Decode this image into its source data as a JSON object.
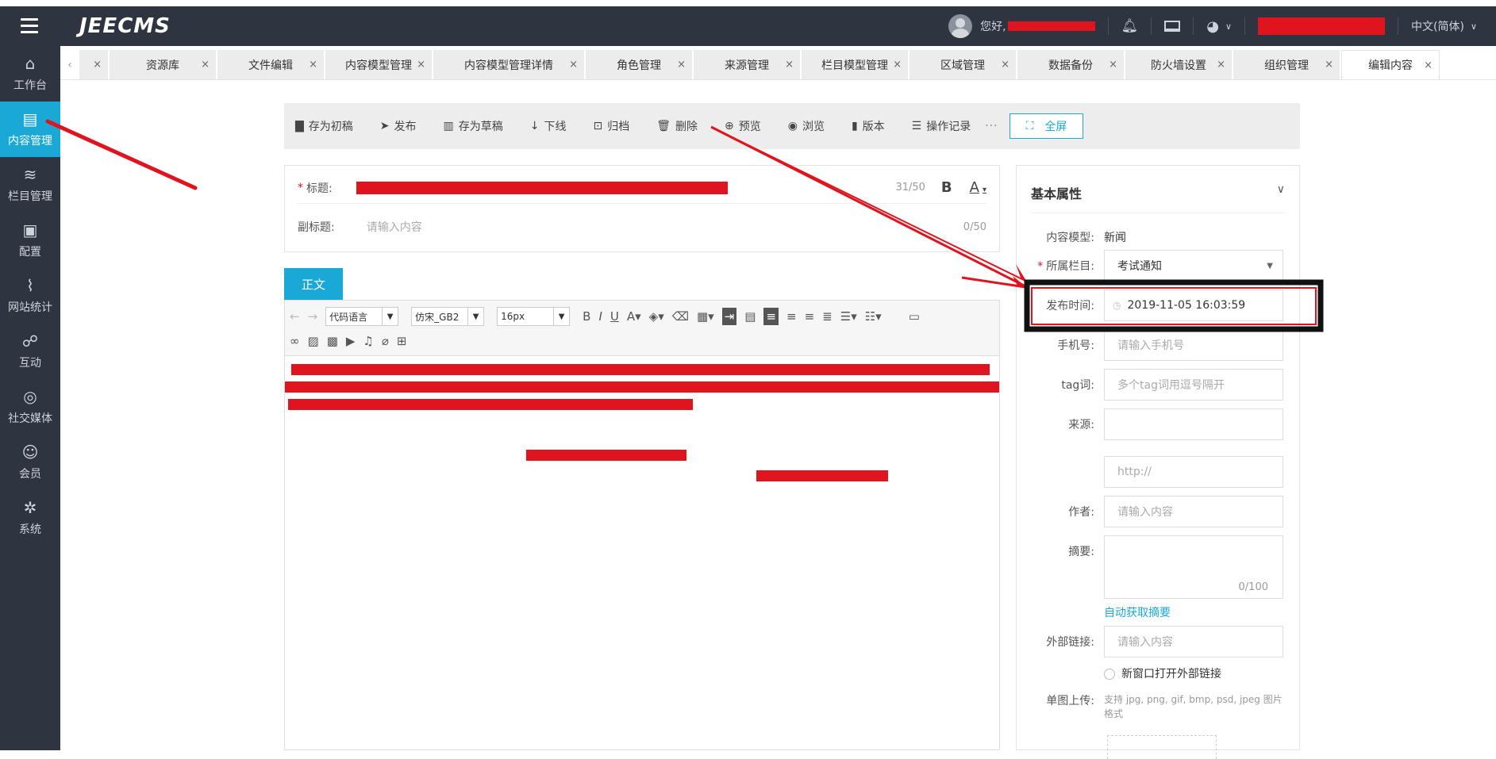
{
  "header": {
    "brand": "JEECMS",
    "greeting": "您好,",
    "language": "中文(简体)",
    "icons": [
      "menu-icon",
      "bell-icon",
      "monitor-icon",
      "palette-icon",
      "chevron-down-icon"
    ]
  },
  "sidebar": {
    "items": [
      {
        "label": "工作台",
        "icon": "⌂",
        "icon_name": "home-icon"
      },
      {
        "label": "内容管理",
        "icon": "▤",
        "icon_name": "document-icon"
      },
      {
        "label": "栏目管理",
        "icon": "≋",
        "icon_name": "layers-icon"
      },
      {
        "label": "配置",
        "icon": "▣",
        "icon_name": "cube-icon"
      },
      {
        "label": "网站统计",
        "icon": "⌇",
        "icon_name": "chart-icon"
      },
      {
        "label": "互动",
        "icon": "☍",
        "icon_name": "chat-icon"
      },
      {
        "label": "社交媒体",
        "icon": "◎",
        "icon_name": "social-icon"
      },
      {
        "label": "会员",
        "icon": "☺",
        "icon_name": "user-icon"
      },
      {
        "label": "系统",
        "icon": "✲",
        "icon_name": "gear-icon"
      }
    ]
  },
  "tabs": [
    "",
    "资源库",
    "文件编辑",
    "内容模型管理",
    "内容模型管理详情",
    "角色管理",
    "来源管理",
    "栏目模型管理",
    "区域管理",
    "数据备份",
    "防火墙设置",
    "组织管理",
    "编辑内容"
  ],
  "toolbar": {
    "buttons": [
      {
        "label": "存为初稿",
        "icon": "▇"
      },
      {
        "label": "发布",
        "icon": "➤"
      },
      {
        "label": "存为草稿",
        "icon": "▥"
      },
      {
        "label": "下线",
        "icon": "↓"
      },
      {
        "label": "归档",
        "icon": "⊡"
      },
      {
        "label": "删除",
        "icon": "🗑"
      },
      {
        "label": "预览",
        "icon": "⊕"
      },
      {
        "label": "浏览",
        "icon": "◉"
      },
      {
        "label": "版本",
        "icon": "▮"
      },
      {
        "label": "操作记录",
        "icon": "☰"
      }
    ],
    "more": "···",
    "fullscreen": "全屏"
  },
  "title_card": {
    "title_label": "标题:",
    "title_counter": "31/50",
    "bold_label": "B",
    "font_color_label": "A",
    "subtitle_label": "副标题:",
    "subtitle_placeholder": "请输入内容",
    "subtitle_counter": "0/50"
  },
  "body_tab": "正文",
  "editor": {
    "code_lang": "代码语言",
    "font_family": "仿宋_GB2",
    "font_size": "16px"
  },
  "panel": {
    "title": "基本属性",
    "content_model_label": "内容模型:",
    "content_model_value": "新闻",
    "column_label": "所属栏目:",
    "column_value": "考试通知",
    "publish_time_label": "发布时间:",
    "publish_time_value": "2019-11-05 16:03:59",
    "phone_label": "手机号:",
    "phone_placeholder": "请输入手机号",
    "tag_label": "tag词:",
    "tag_placeholder": "多个tag词用逗号隔开",
    "source_label": "来源:",
    "source_url_placeholder": "http://",
    "author_label": "作者:",
    "author_placeholder": "请输入内容",
    "summary_label": "摘要:",
    "summary_counter": "0/100",
    "auto_summary": "自动获取摘要",
    "external_link_label": "外部链接:",
    "external_link_placeholder": "请输入内容",
    "new_window_label": "新窗口打开外部链接",
    "image_upload_label": "单图上传:",
    "image_upload_hint": "支持 jpg, png, gif, bmp, psd, jpeg 图片格式"
  },
  "colors": {
    "accent": "#1aa9d6",
    "dark": "#2f3540",
    "annotation": "#e0141e"
  }
}
